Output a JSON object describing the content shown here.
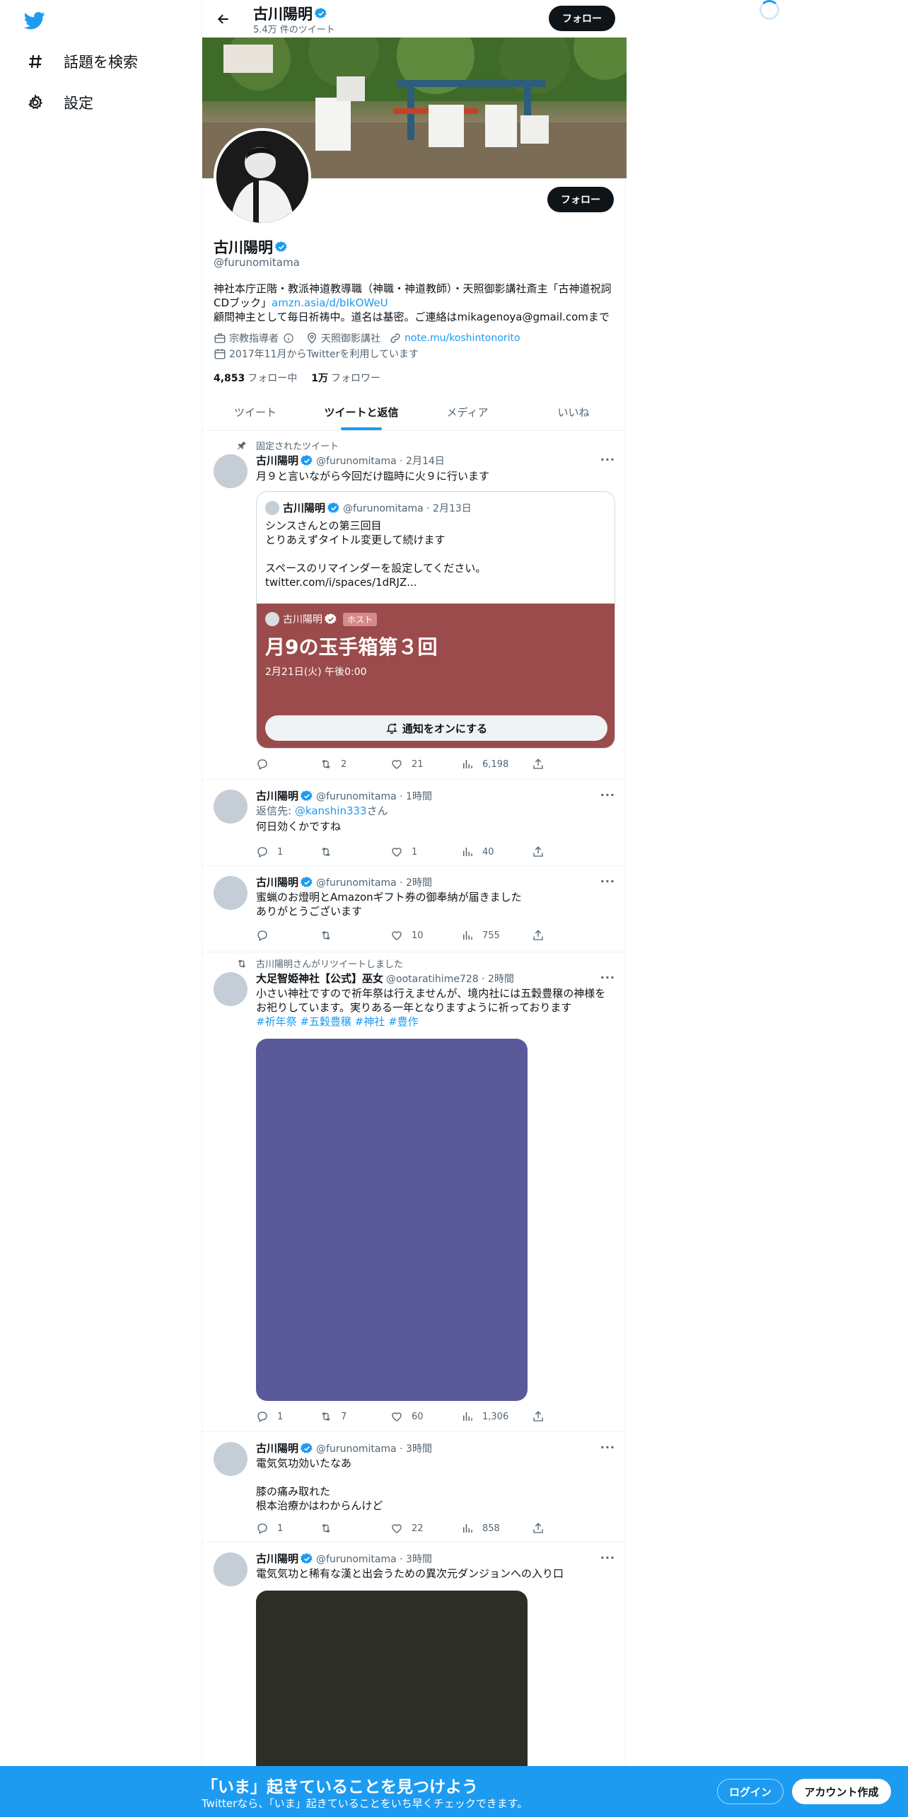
{
  "nav": {
    "logo_icon": "twitter-bird-icon",
    "items": [
      {
        "label": "話題を検索",
        "icon": "hashtag-icon"
      },
      {
        "label": "設定",
        "icon": "gear-icon"
      }
    ]
  },
  "header": {
    "name": "古川陽明",
    "tweet_count": "5.4万 件のツイート",
    "follow_label": "フォロー"
  },
  "profile": {
    "name": "古川陽明",
    "handle": "@furunomitama",
    "bio_text": "神社本庁正階・教派神道教導職（神職・神道教師）・天照御影講社斎主「古神道祝詞CDブック」",
    "bio_link": "amzn.asia/d/bIkOWeU",
    "bio_text2": "顧問神主として毎日祈祷中。道名は基密。ご連絡はmikagenoya@gmail.comまで",
    "category": "宗教指導者",
    "location": "天照御影講社",
    "website": "note.mu/koshintonorito",
    "joined": "2017年11月からTwitterを利用しています",
    "following_count": "4,853",
    "following_label": "フォロー中",
    "followers_count": "1万",
    "followers_label": "フォロワー",
    "follow_label": "フォロー"
  },
  "tabs": [
    {
      "label": "ツイート"
    },
    {
      "label": "ツイートと返信"
    },
    {
      "label": "メディア"
    },
    {
      "label": "いいね"
    }
  ],
  "tweets": [
    {
      "context": "固定されたツイート",
      "name": "古川陽明",
      "meta": "@furunomitama · 2月14日",
      "text": "月９と言いながら今回だけ臨時に火９に行います",
      "quote": {
        "name": "古川陽明",
        "meta": "@furunomitama · 2月13日",
        "text": "シンスさんとの第三回目\nとりあえずタイトル変更して続けます\n\nスペースのリマインダーを設定してください。\ntwitter.com/i/spaces/1dRJZ...",
        "space": {
          "host_name": "古川陽明",
          "host_badge": "ホスト",
          "title": "月9の玉手箱第３回",
          "date": "2月21日(火) 午後0:00",
          "button": "通知をオンにする",
          "color": "#9b4b4b"
        }
      },
      "replies": "",
      "retweets": "2",
      "likes": "21",
      "views": "6,198"
    },
    {
      "name": "古川陽明",
      "meta": "@furunomitama · 1時間",
      "reply_to_prefix": "返信先: ",
      "reply_to_handle": "@kanshin333",
      "reply_to_suffix": "さん",
      "text": "何日効くかですね",
      "replies": "1",
      "retweets": "",
      "likes": "1",
      "views": "40"
    },
    {
      "name": "古川陽明",
      "meta": "@furunomitama · 2時間",
      "text": "蜜蝋のお燈明とAmazonギフト券の御奉納が届きました\nありがとうございます",
      "replies": "",
      "retweets": "",
      "likes": "10",
      "views": "755"
    },
    {
      "context": "古川陽明さんがリツイートしました",
      "name": "大足智姫神社【公式】巫女",
      "meta": "@ootaratihime728 · 2時間",
      "text": "小さい神社ですので祈年祭は行えませんが、境内社には五穀豊穣の神様をお祀りしています。実りある一年となりますように祈っております",
      "hashtags": "#祈年祭 #五穀豊穣 #神社 #豊作",
      "media_color": "#5a5a9a",
      "replies": "1",
      "retweets": "7",
      "likes": "60",
      "views": "1,306"
    },
    {
      "name": "古川陽明",
      "meta": "@furunomitama · 3時間",
      "text": "電気気功効いたなあ\n\n膝の痛み取れた\n根本治療かはわからんけど",
      "replies": "1",
      "retweets": "",
      "likes": "22",
      "views": "858"
    },
    {
      "name": "古川陽明",
      "meta": "@furunomitama · 3時間",
      "text": "電気気功と稀有な漢と出会うための異次元ダンジョンへの入り口",
      "media_color": "#2e2e28"
    }
  ],
  "bottom_bar": {
    "title": "「いま」起きていることを見つけよう",
    "subtitle": "Twitterなら、「いま」起きていることをいち早くチェックできます。",
    "login_label": "ログイン",
    "signup_label": "アカウント作成"
  },
  "colors": {
    "accent": "#1d9bf0",
    "text": "#0f1419",
    "muted": "#536471"
  }
}
